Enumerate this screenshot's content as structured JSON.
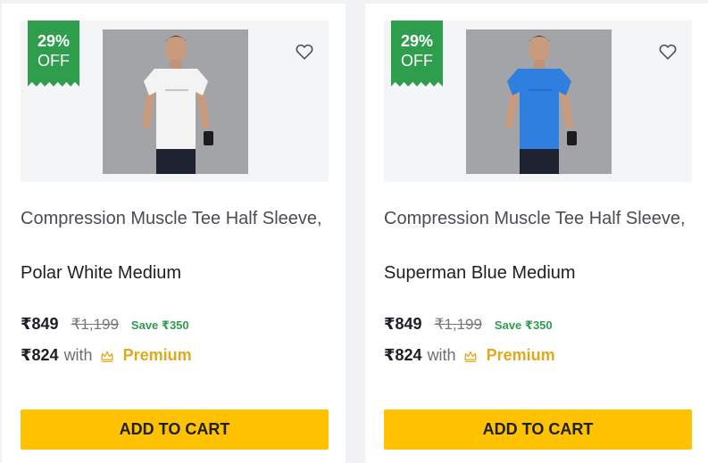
{
  "products": [
    {
      "discount_pct": "29%",
      "discount_off": "OFF",
      "title": "Compression Muscle Tee Half Sleeve,",
      "variant": "Polar White Medium",
      "price": "₹849",
      "mrp": "₹1,199",
      "save": "Save ₹350",
      "premium_price": "₹824",
      "with_text": "with",
      "premium_label": "Premium",
      "cta": "ADD TO CART",
      "shirt_color": "#f3f3f3",
      "icons": {
        "wishlist": "heart-icon",
        "premium": "crown-icon"
      }
    },
    {
      "discount_pct": "29%",
      "discount_off": "OFF",
      "title": "Compression Muscle Tee Half Sleeve,",
      "variant": "Superman Blue Medium",
      "price": "₹849",
      "mrp": "₹1,199",
      "save": "Save ₹350",
      "premium_price": "₹824",
      "with_text": "with",
      "premium_label": "Premium",
      "cta": "ADD TO CART",
      "shirt_color": "#2f7fe0",
      "icons": {
        "wishlist": "heart-icon",
        "premium": "crown-icon"
      }
    }
  ],
  "colors": {
    "badge_green": "#2e9e4d",
    "save_green": "#2e9e4d",
    "premium_gold": "#e0a91c",
    "cta_yellow": "#ffc200"
  }
}
